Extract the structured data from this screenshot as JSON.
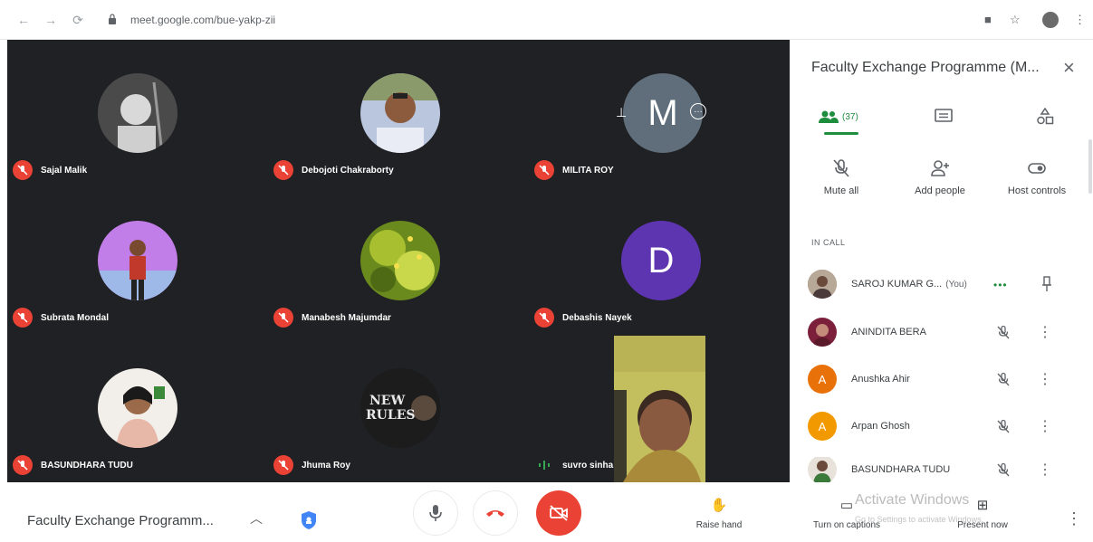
{
  "browser": {
    "url": "meet.google.com/bue-yakp-zii"
  },
  "tiles": [
    {
      "name": "Sajal Malik",
      "muted": true,
      "avatar_color": "#3a3a3a"
    },
    {
      "name": "Debojoti Chakraborty",
      "muted": true,
      "avatar_color": "#a8b8d8"
    },
    {
      "name": "MILITA ROY",
      "muted": true,
      "avatar_letter": "M",
      "avatar_color": "#5f6e7a"
    },
    {
      "name": "Subrata Mondal",
      "muted": true,
      "avatar_color": "#b06ad8"
    },
    {
      "name": "Manabesh Majumdar",
      "muted": true,
      "avatar_color": "#7a9a2a"
    },
    {
      "name": "Debashis Nayek",
      "muted": true,
      "avatar_letter": "D",
      "avatar_color": "#5e35b1"
    },
    {
      "name": "BASUNDHARA TUDU",
      "muted": true,
      "avatar_color": "#e9d2c0"
    },
    {
      "name": "Jhuma Roy",
      "muted": true,
      "avatar_text": "NEW RULES",
      "avatar_color": "#1a1a1a"
    },
    {
      "name": "suvro sinha",
      "muted": false,
      "speaking": true
    }
  ],
  "side_panel": {
    "title": "Faculty Exchange Programme (M...",
    "people_count": "(37)",
    "actions": [
      {
        "label": "Mute all",
        "icon": "mic-off-icon"
      },
      {
        "label": "Add people",
        "icon": "person-add-icon"
      },
      {
        "label": "Host controls",
        "icon": "toggle-icon"
      }
    ],
    "section_label": "IN CALL",
    "participants": [
      {
        "name": "SAROJ KUMAR G...",
        "tag": "(You)",
        "avatar_color": "#8d6e63",
        "speaking": true
      },
      {
        "name": "ANINDITA BERA",
        "avatar_color": "#7b1f3a"
      },
      {
        "name": "Anushka Ahir",
        "avatar_letter": "A",
        "avatar_color": "#e8710a"
      },
      {
        "name": "Arpan Ghosh",
        "avatar_letter": "A",
        "avatar_color": "#f29900"
      },
      {
        "name": "BASUNDHARA TUDU",
        "avatar_color": "#3b7a3b"
      }
    ]
  },
  "bottom_bar": {
    "meeting_title": "Faculty Exchange Programm...",
    "raise_hand": "Raise hand",
    "captions": "Turn on captions",
    "present": "Present now",
    "watermark": "Activate Windows",
    "watermark_sub": "Go to Settings to activate Windows."
  }
}
